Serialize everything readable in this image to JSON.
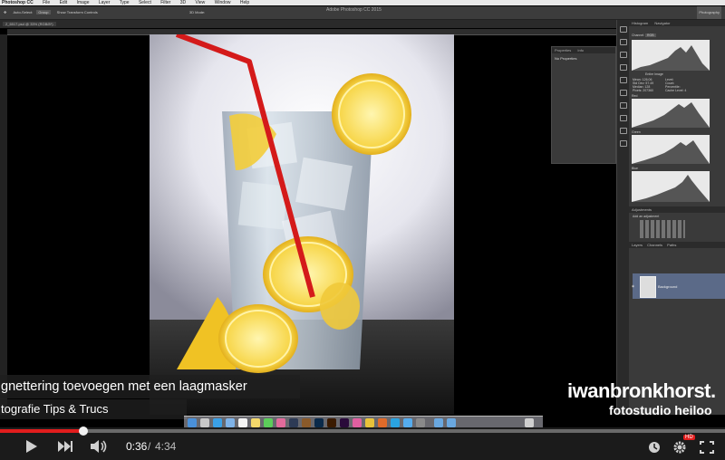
{
  "app": {
    "menu": [
      "Photoshop CC",
      "File",
      "Edit",
      "Image",
      "Layer",
      "Type",
      "Select",
      "Filter",
      "3D",
      "View",
      "Window",
      "Help"
    ],
    "window_title": "Adobe Photoshop CC 2015",
    "options": {
      "auto_select": "Auto-Select:",
      "layer_select": "Group",
      "transform": "Show Transform Controls",
      "mode_3d": "3D Mode:"
    },
    "document_tab": "2_6517.psd @ 33% (RGB/8*)",
    "workspace": "Photography"
  },
  "panels": {
    "properties": {
      "tabs": [
        "Properties",
        "Info"
      ],
      "empty_text": "No Properties"
    },
    "histogram": {
      "tabs": [
        "Histogram",
        "Navigator"
      ],
      "channel_label": "Channel:",
      "channel_value": "RGB",
      "source": "Entire Image",
      "stats": [
        "Mean: 126.06",
        "Std Dev: 57.49",
        "Median: 128",
        "Pixels: 207360"
      ],
      "stats_right": [
        "Level:",
        "Count:",
        "Percentile:",
        "Cache Level: 4"
      ],
      "red": "Red",
      "green": "Green",
      "blue": "Blue"
    },
    "adjustments": {
      "title": "Adjustments",
      "subtitle": "Add an adjustment"
    },
    "layers": {
      "tabs": [
        "Layers",
        "Channels",
        "Paths"
      ],
      "layer_name": "Background"
    }
  },
  "overlay": {
    "caption_line1": "gnettering toevoegen met een laagmasker",
    "caption_line2": "tografie Tips & Trucs",
    "brand_name": "iwanbronkhorst.",
    "brand_sub": "fotostudio heiloo"
  },
  "player": {
    "time_current": "0:36",
    "time_separator": "/",
    "time_total": "4:34",
    "progress_fraction": 0.115,
    "hd_label": "HD",
    "accent_color": "#e21d1d"
  }
}
